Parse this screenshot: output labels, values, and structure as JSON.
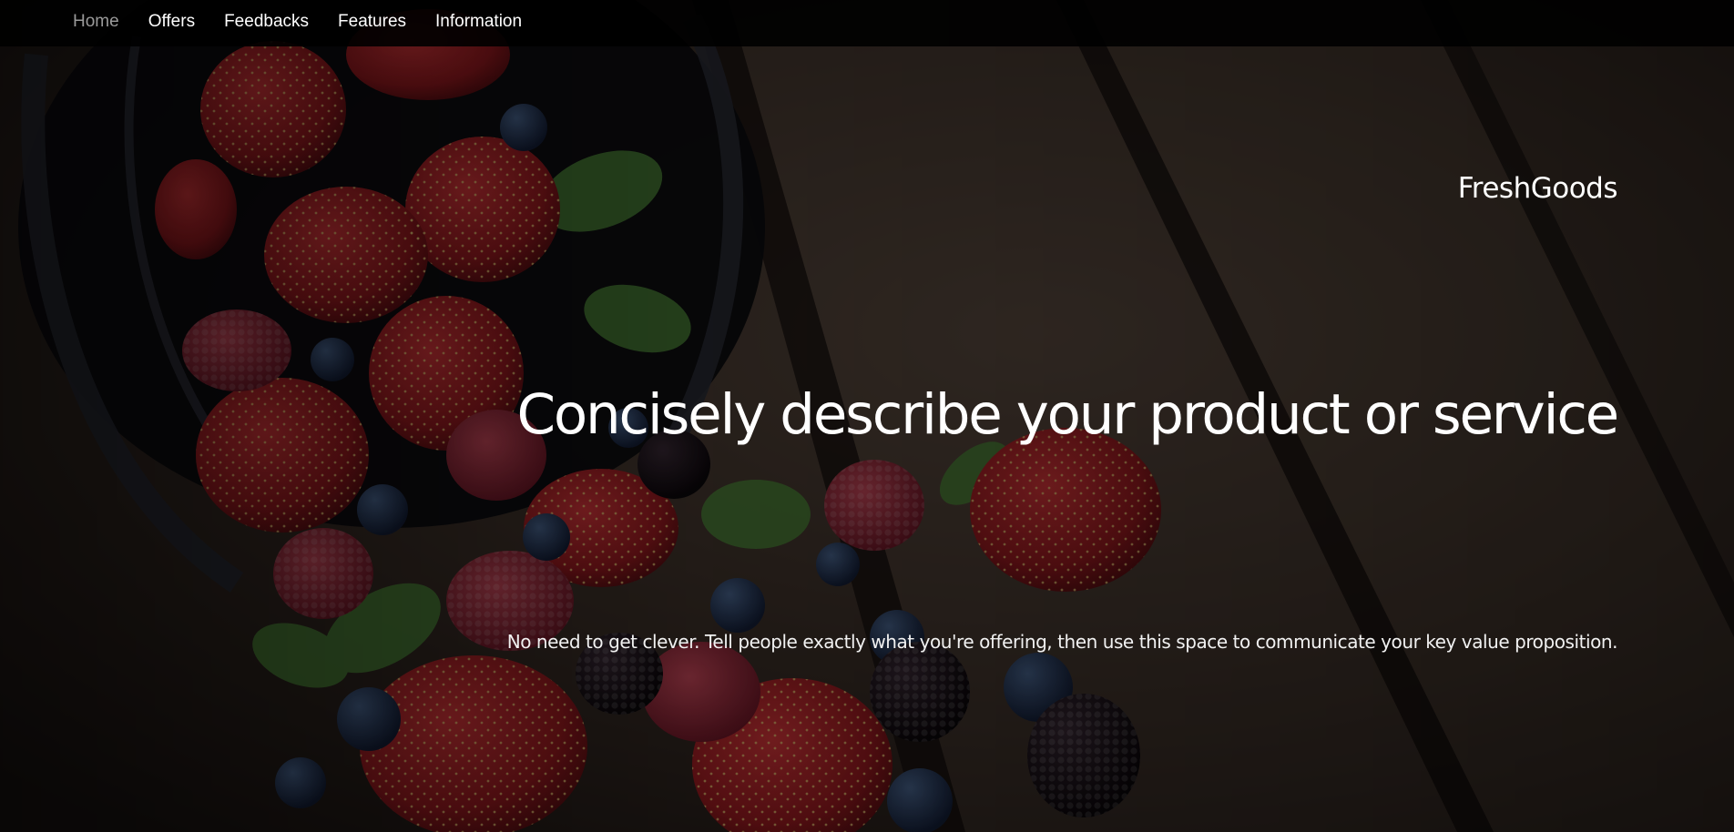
{
  "nav": {
    "items": [
      {
        "label": "Home",
        "active": true
      },
      {
        "label": "Offers",
        "active": false
      },
      {
        "label": "Feedbacks",
        "active": false
      },
      {
        "label": "Features",
        "active": false
      },
      {
        "label": "Information",
        "active": false
      }
    ]
  },
  "hero": {
    "brand": "FreshGoods",
    "headline": "Concisely describe your product or service",
    "subtext": "No need to get clever. Tell people exactly what you're offering, then use this space to communicate your key value proposition.",
    "background_image": "strawberries-raspberries-blueberries-blackberries-spilling-from-basket-onto-wooden-table"
  },
  "colors": {
    "navbar_bg": "#000000",
    "nav_text": "#ffffff",
    "nav_active_text": "#9a9a9a",
    "hero_text": "#ffffff"
  }
}
